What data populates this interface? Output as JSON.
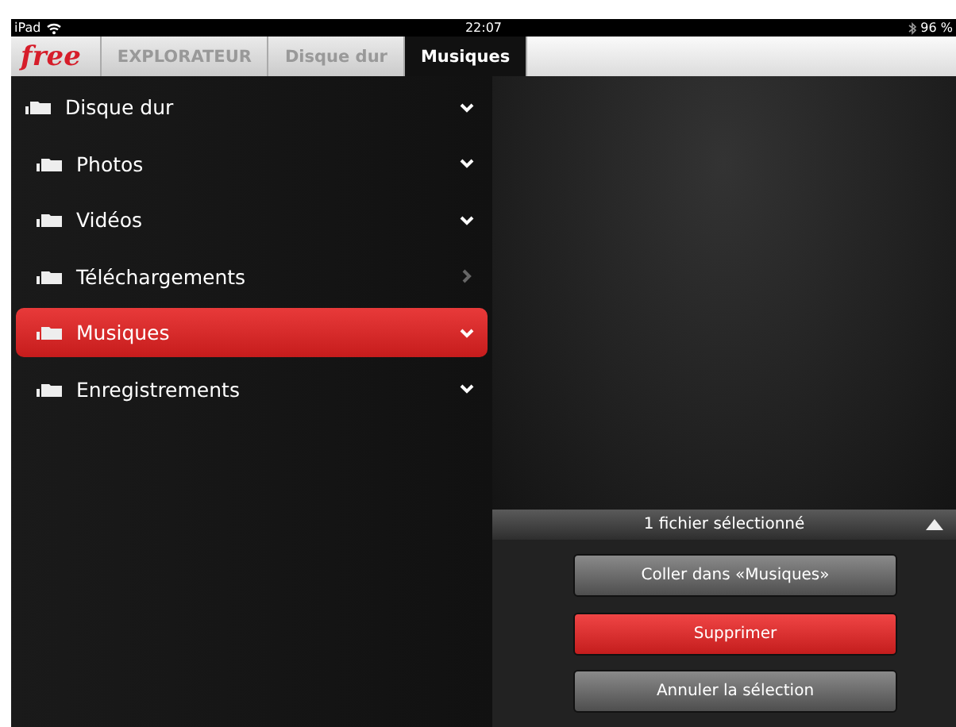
{
  "status_bar": {
    "device": "iPad",
    "time": "22:07",
    "battery": "96 %"
  },
  "breadcrumb": {
    "logo": "free",
    "items": [
      {
        "label": "EXPLORATEUR",
        "selected": false
      },
      {
        "label": "Disque dur",
        "selected": false
      },
      {
        "label": "Musiques",
        "selected": true
      }
    ]
  },
  "tree": [
    {
      "label": "Disque dur",
      "expanded": true,
      "selected": false,
      "children": [
        {
          "label": "Photos",
          "expanded": true,
          "selected": false
        },
        {
          "label": "Vidéos",
          "expanded": true,
          "selected": false
        },
        {
          "label": "Téléchargements",
          "expanded": false,
          "selected": false
        },
        {
          "label": "Musiques",
          "expanded": true,
          "selected": true
        },
        {
          "label": "Enregistrements",
          "expanded": true,
          "selected": false
        }
      ]
    }
  ],
  "selection_panel": {
    "title": "1 fichier sélectionné",
    "buttons": [
      {
        "label": "Coller dans «Musiques»",
        "kind": "normal"
      },
      {
        "label": "Supprimer",
        "kind": "danger"
      },
      {
        "label": "Annuler la sélection",
        "kind": "normal"
      }
    ]
  }
}
